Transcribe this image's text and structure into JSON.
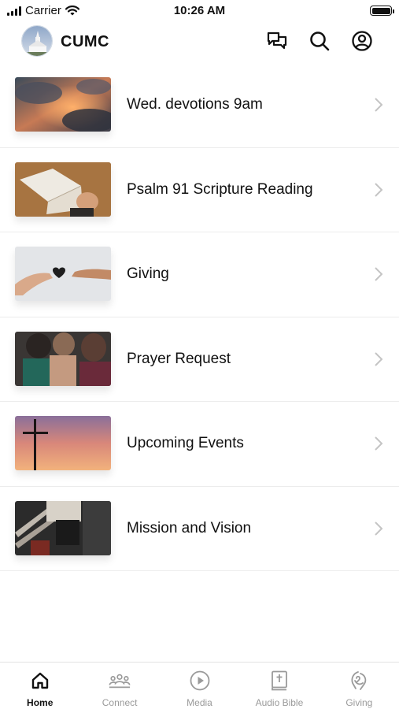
{
  "status_bar": {
    "carrier": "Carrier",
    "time": "10:26 AM"
  },
  "header": {
    "org_name": "CUMC",
    "icons": [
      "chat-icon",
      "search-icon",
      "account-icon"
    ]
  },
  "items": [
    {
      "label": "Wed. devotions 9am",
      "thumb": "sunset-clouds"
    },
    {
      "label": "Psalm 91 Scripture Reading",
      "thumb": "open-bible"
    },
    {
      "label": "Giving",
      "thumb": "hands-heart"
    },
    {
      "label": "Prayer Request",
      "thumb": "people-praying"
    },
    {
      "label": "Upcoming Events",
      "thumb": "cross-sunset"
    },
    {
      "label": "Mission and Vision",
      "thumb": "stairs-sitting"
    }
  ],
  "tabs": [
    {
      "label": "Home",
      "icon": "home-icon",
      "active": true
    },
    {
      "label": "Connect",
      "icon": "people-icon",
      "active": false
    },
    {
      "label": "Media",
      "icon": "play-icon",
      "active": false
    },
    {
      "label": "Audio Bible",
      "icon": "bible-icon",
      "active": false
    },
    {
      "label": "Giving",
      "icon": "giving-icon",
      "active": false
    }
  ],
  "colors": {
    "active_tab": "#111111",
    "inactive_tab": "#9a9a9a",
    "divider": "#ececec"
  }
}
